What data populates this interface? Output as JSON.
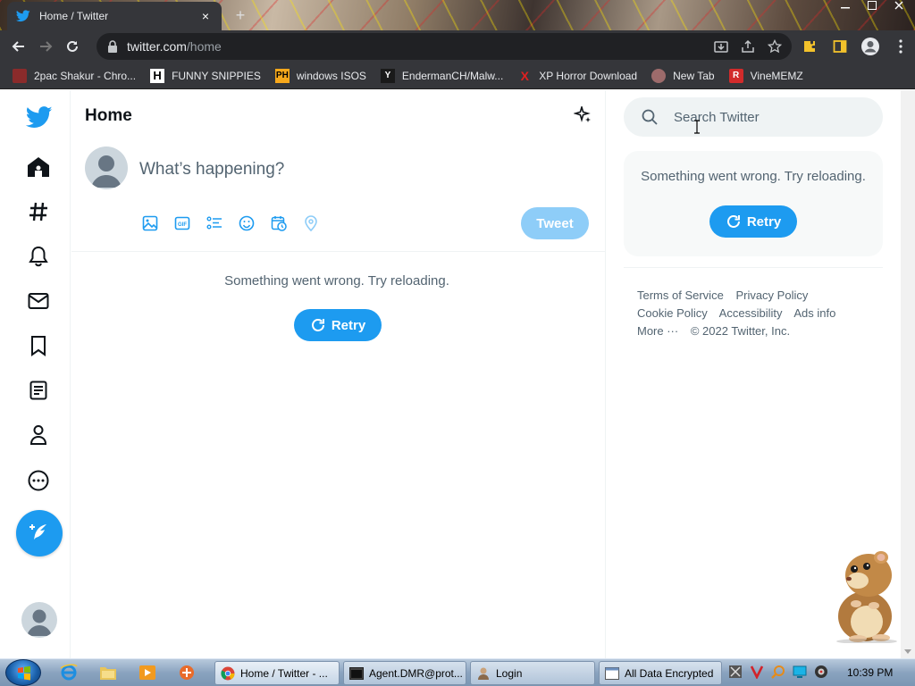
{
  "browser": {
    "tab_title": "Home / Twitter",
    "tab_close": "×",
    "new_tab": "+",
    "url_host": "twitter.com",
    "url_path": "/home"
  },
  "bookmarks": [
    {
      "label": "2pac Shakur - Chro...",
      "icon": "tupac-icon",
      "icon_color": "#8a2b2b"
    },
    {
      "label": "FUNNY SNIPPIES",
      "icon": "h-icon",
      "icon_text": "H",
      "icon_color": "#ffffff"
    },
    {
      "label": "windows ISOS",
      "icon": "ph-icon",
      "icon_text": "PH",
      "icon_color": "#f7a81b"
    },
    {
      "label": "EndermanCH/Malw...",
      "icon": "yt-icon",
      "icon_text": "Y",
      "icon_color": "#2b2b2b"
    },
    {
      "label": "XP Horror Download",
      "icon": "x-icon",
      "icon_text": "X",
      "icon_color": "#e02020"
    },
    {
      "label": "New Tab",
      "icon": "globe-icon",
      "icon_color": "#9d6b6b"
    },
    {
      "label": "VineMEMZ",
      "icon": "r-icon",
      "icon_text": "R",
      "icon_color": "#d22b2b"
    }
  ],
  "twitter": {
    "header_title": "Home",
    "composer_placeholder": "What’s happening?",
    "tweet_button": "Tweet",
    "error_message": "Something went wrong. Try reloading.",
    "retry_label": "Retry",
    "search_placeholder": "Search Twitter",
    "sidebar_error": "Something went wrong. Try reloading.",
    "sidebar_retry": "Retry",
    "footer": {
      "terms": "Terms of Service",
      "privacy": "Privacy Policy",
      "cookie": "Cookie Policy",
      "accessibility": "Accessibility",
      "ads": "Ads info",
      "more": "More ···",
      "copyright": "© 2022 Twitter, Inc."
    },
    "brand_color": "#1d9bf0"
  },
  "taskbar": {
    "tasks": [
      {
        "label": "Home / Twitter - ...",
        "icon": "chrome-icon"
      },
      {
        "label": "Agent.DMR@prot...",
        "icon": "terminal-icon"
      },
      {
        "label": "Login",
        "icon": "user-icon"
      },
      {
        "label": "All Data Encrypted",
        "icon": "window-icon"
      }
    ],
    "clock": "10:39 PM"
  }
}
